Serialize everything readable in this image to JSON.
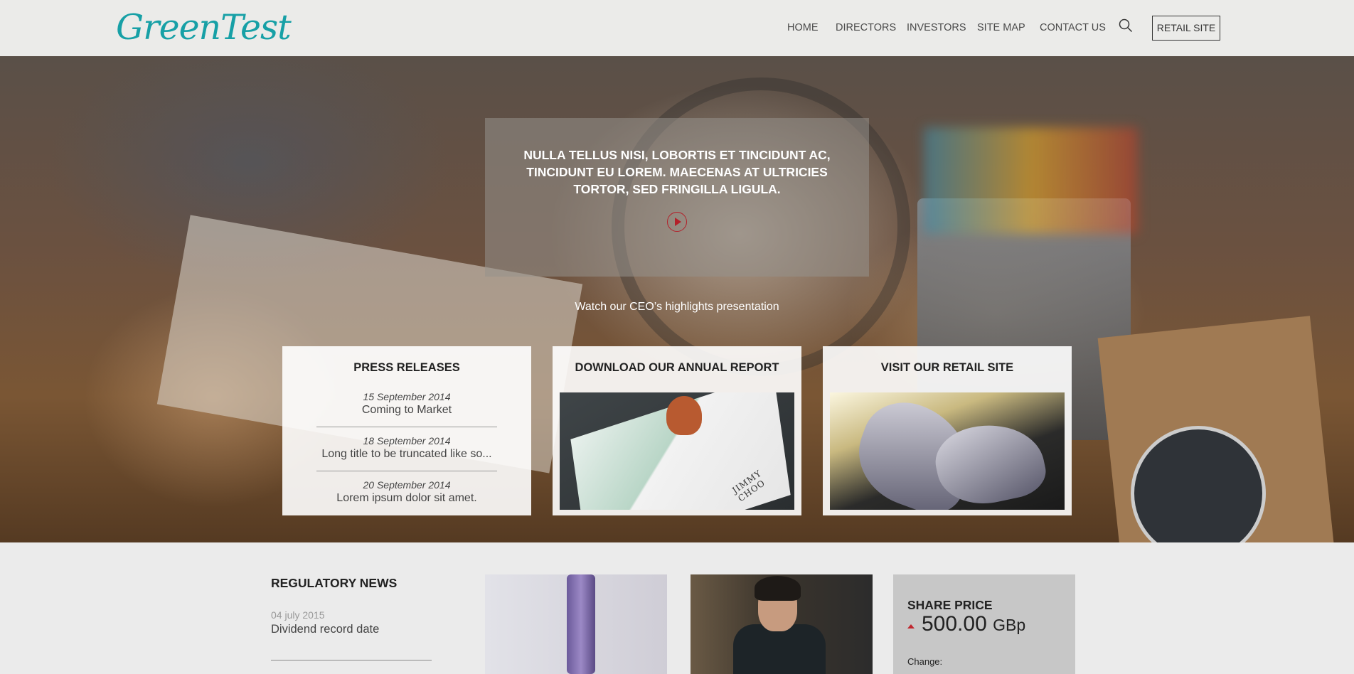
{
  "header": {
    "logo": "GreenTest",
    "nav": [
      "HOME",
      "DIRECTORS",
      "INVESTORS",
      "SITE MAP",
      "CONTACT US"
    ],
    "retail_button": "RETAIL SITE",
    "search_icon": "search-icon"
  },
  "hero": {
    "headline": "NULLA TELLUS NISI, LOBORTIS ET TINCIDUNT AC, TINCIDUNT EU LOREM. MAECENAS AT ULTRICIES TORTOR, SED FRINGILLA LIGULA.",
    "video_link": "Watch our CEO’s highlights presentation",
    "play_icon": "play-icon"
  },
  "cards": {
    "press": {
      "title": "PRESS RELEASES",
      "items": [
        {
          "date": "15 September 2014",
          "title": "Coming to Market"
        },
        {
          "date": "18 September 2014",
          "title": "Long title to be truncated like so..."
        },
        {
          "date": "20 September 2014",
          "title": "Lorem ipsum dolor sit amet."
        }
      ]
    },
    "report": {
      "title": "DOWNLOAD OUR ANNUAL REPORT",
      "image_brand": "JIMMY CHOO"
    },
    "retail": {
      "title": "VISIT OUR RETAIL SITE"
    }
  },
  "bottom": {
    "regulatory": {
      "title": "REGULATORY NEWS",
      "items": [
        {
          "date": "04 july 2015",
          "title": "Dividend record date"
        }
      ]
    },
    "share": {
      "title": "SHARE PRICE",
      "value": "500.00",
      "unit": "GBp",
      "change_label": "Change:",
      "arrow_color": "#c0262e"
    }
  },
  "colors": {
    "brand": "#17a0a6",
    "accent": "#b3202a"
  }
}
